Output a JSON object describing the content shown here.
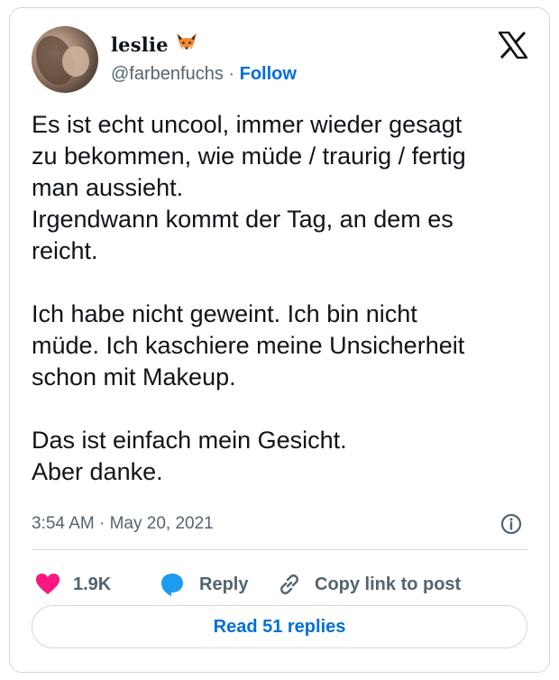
{
  "author": {
    "display_name": "leslie",
    "emoji_icon": "fox-face-icon",
    "handle": "@farbenfuchs",
    "separator": " · ",
    "follow_label": "Follow"
  },
  "platform_icon": "x-logo-icon",
  "tweet": {
    "text": "Es ist echt uncool, immer wieder gesagt\nzu bekommen, wie müde / traurig / fertig\nman aussieht.\nIrgendwann kommt der Tag, an dem es\nreicht.\n\nIch habe nicht geweint. Ich bin nicht\nmüde. Ich kaschiere meine Unsicherheit\nschon mit Makeup.\n\nDas ist einfach mein Gesicht.\nAber danke.",
    "timestamp": "3:54 AM · May 20, 2021"
  },
  "actions": {
    "likes": "1.9K",
    "reply_label": "Reply",
    "copy_label": "Copy link to post"
  },
  "read_replies_label": "Read 51 replies",
  "colors": {
    "like": "#f91880",
    "reply": "#1d9bf0",
    "link": "#006fd6",
    "muted": "#536471",
    "border": "#cfd9de"
  }
}
